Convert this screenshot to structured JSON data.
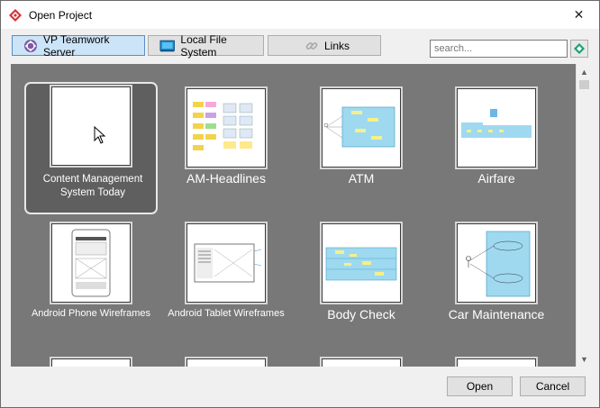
{
  "window": {
    "title": "Open Project",
    "close_symbol": "✕"
  },
  "toolbar": {
    "tabs": [
      {
        "label": "VP Teamwork Server",
        "icon": "teamwork-server-icon",
        "active": true
      },
      {
        "label": "Local File System",
        "icon": "local-file-system-icon",
        "active": false
      },
      {
        "label": "Links",
        "icon": "links-icon",
        "active": false
      }
    ],
    "search": {
      "placeholder": "search..."
    }
  },
  "projects": [
    {
      "name": "Content Management System Today",
      "selected": true
    },
    {
      "name": "AM-Headlines",
      "selected": false
    },
    {
      "name": "ATM",
      "selected": false
    },
    {
      "name": "Airfare",
      "selected": false
    },
    {
      "name": "Android Phone Wireframes",
      "selected": false
    },
    {
      "name": "Android Tablet Wireframes",
      "selected": false
    },
    {
      "name": "Body Check",
      "selected": false
    },
    {
      "name": "Car Maintenance",
      "selected": false
    }
  ],
  "footer": {
    "open_label": "Open",
    "cancel_label": "Cancel"
  },
  "colors": {
    "grid_background": "#787878",
    "active_tab": "#cce4f7",
    "accent": "#0078d7"
  }
}
